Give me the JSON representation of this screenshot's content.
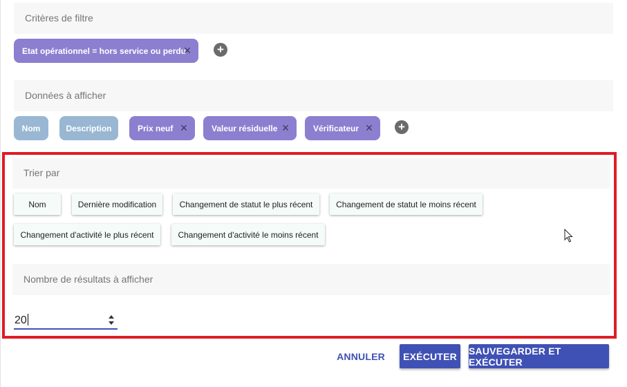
{
  "filter": {
    "header": "Critères de filtre",
    "chips": [
      {
        "label": "Etat opérationnel = hors service ou perdu",
        "removable": true
      }
    ],
    "add_icon": "plus-circle-icon"
  },
  "display": {
    "header": "Données à afficher",
    "chips": [
      {
        "label": "Nom",
        "removable": false
      },
      {
        "label": "Description",
        "removable": false
      },
      {
        "label": "Prix neuf",
        "removable": true
      },
      {
        "label": "Valeur résiduelle",
        "removable": true
      },
      {
        "label": "Vérificateur",
        "removable": true
      }
    ],
    "add_icon": "plus-circle-icon"
  },
  "sort": {
    "header": "Trier par",
    "options": [
      "Nom",
      "Dernière modification",
      "Changement de statut le plus récent",
      "Changement de statut le moins récent",
      "Changement d'activité le plus récent",
      "Changement d'activité le moins récent"
    ]
  },
  "results": {
    "header": "Nombre de résultats à afficher",
    "value": "20"
  },
  "actions": {
    "cancel_label": "ANNULER",
    "execute_label": "EXÉCUTER",
    "save_execute_label": "SAUVEGARDER ET EXÉCUTER"
  },
  "colors": {
    "primary": "#3f51b5",
    "chip_purple": "#8c7fd0",
    "chip_blue": "#99b7d3",
    "highlight": "#e01b24"
  }
}
